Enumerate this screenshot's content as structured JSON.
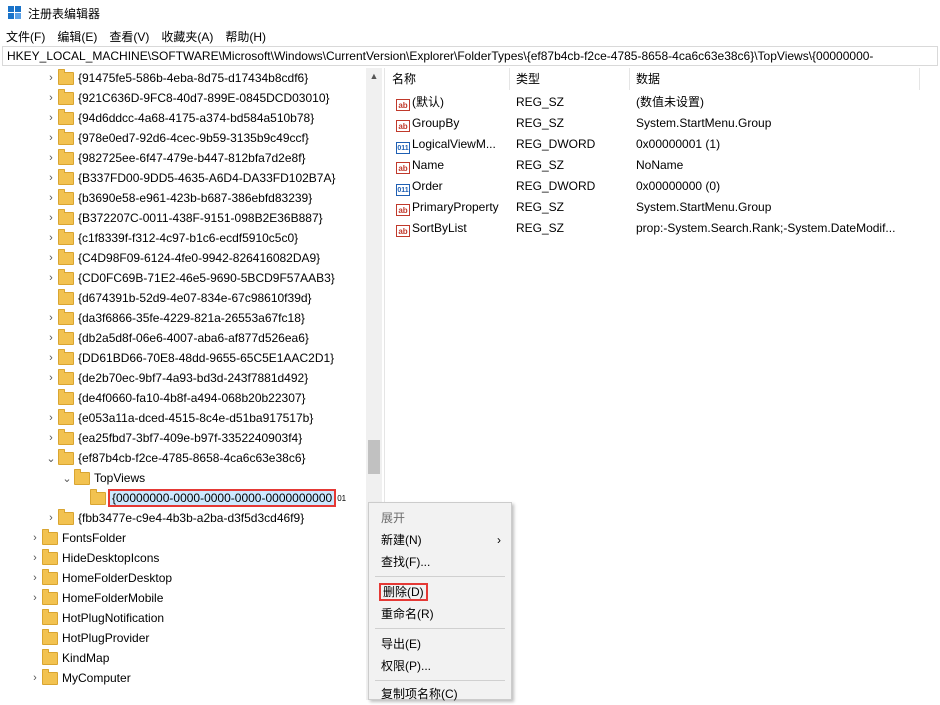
{
  "window": {
    "title": "注册表编辑器",
    "accent": "#1a73c9"
  },
  "menubar": {
    "items": [
      "文件(F)",
      "编辑(E)",
      "查看(V)",
      "收藏夹(A)",
      "帮助(H)"
    ]
  },
  "address": {
    "path": "HKEY_LOCAL_MACHINE\\SOFTWARE\\Microsoft\\Windows\\CurrentVersion\\Explorer\\FolderTypes\\{ef87b4cb-f2ce-4785-8658-4ca6c63e38c6}\\TopViews\\{00000000-"
  },
  "tree": {
    "items": [
      "{91475fe5-586b-4eba-8d75-d17434b8cdf6}",
      "{921C636D-9FC8-40d7-899E-0845DCD03010}",
      "{94d6ddcc-4a68-4175-a374-bd584a510b78}",
      "{978e0ed7-92d6-4cec-9b59-3135b9c49ccf}",
      "{982725ee-6f47-479e-b447-812bfa7d2e8f}",
      "{B337FD00-9DD5-4635-A6D4-DA33FD102B7A}",
      "{b3690e58-e961-423b-b687-386ebfd83239}",
      "{B372207C-0011-438F-9151-098B2E36B887}",
      "{c1f8339f-f312-4c97-b1c6-ecdf5910c5c0}",
      "{C4D98F09-6124-4fe0-9942-826416082DA9}",
      "{CD0FC69B-71E2-46e5-9690-5BCD9F57AAB3}",
      "{d674391b-52d9-4e07-834e-67c98610f39d}",
      "{da3f6866-35fe-4229-821a-26553a67fc18}",
      "{db2a5d8f-06e6-4007-aba6-af877d526ea6}",
      "{DD61BD66-70E8-48dd-9655-65C5E1AAC2D1}",
      "{de2b70ec-9bf7-4a93-bd3d-243f7881d492}",
      "{de4f0660-fa10-4b8f-a494-068b20b22307}",
      "{e053a11a-dced-4515-8c4e-d51ba917517b}",
      "{ea25fbd7-3bf7-409e-b97f-3352240903f4}",
      "{ef87b4cb-f2ce-4785-8658-4ca6c63e38c6}",
      "TopViews",
      "{00000000-0000-0000-0000-0000000000",
      "{fbb3477e-c9e4-4b3b-a2ba-d3f5d3cd46f9}",
      "FontsFolder",
      "HideDesktopIcons",
      "HomeFolderDesktop",
      "HomeFolderMobile",
      "HotPlugNotification",
      "HotPlugProvider",
      "KindMap",
      "MyComputer"
    ],
    "selected_suffix": "01"
  },
  "values": {
    "headers": {
      "name": "名称",
      "type": "类型",
      "data": "数据"
    },
    "rows": [
      {
        "icon": "string-value-icon",
        "name": "(默认)",
        "type": "REG_SZ",
        "data": "(数值未设置)"
      },
      {
        "icon": "string-value-icon",
        "name": "GroupBy",
        "type": "REG_SZ",
        "data": "System.StartMenu.Group"
      },
      {
        "icon": "dword-value-icon",
        "name": "LogicalViewM...",
        "type": "REG_DWORD",
        "data": "0x00000001 (1)"
      },
      {
        "icon": "string-value-icon",
        "name": "Name",
        "type": "REG_SZ",
        "data": "NoName"
      },
      {
        "icon": "dword-value-icon",
        "name": "Order",
        "type": "REG_DWORD",
        "data": "0x00000000 (0)"
      },
      {
        "icon": "string-value-icon",
        "name": "PrimaryProperty",
        "type": "REG_SZ",
        "data": "System.StartMenu.Group"
      },
      {
        "icon": "string-value-icon",
        "name": "SortByList",
        "type": "REG_SZ",
        "data": "prop:-System.Search.Rank;-System.DateModif..."
      }
    ]
  },
  "context_menu": {
    "expand": "展开",
    "new": "新建(N)",
    "new_arrow": "›",
    "find": "查找(F)...",
    "delete": "删除(D)",
    "rename": "重命名(R)",
    "export": "导出(E)",
    "permissions": "权限(P)...",
    "copy_key_name": "复制项名称(C)"
  },
  "highlight_color": "#e53935"
}
